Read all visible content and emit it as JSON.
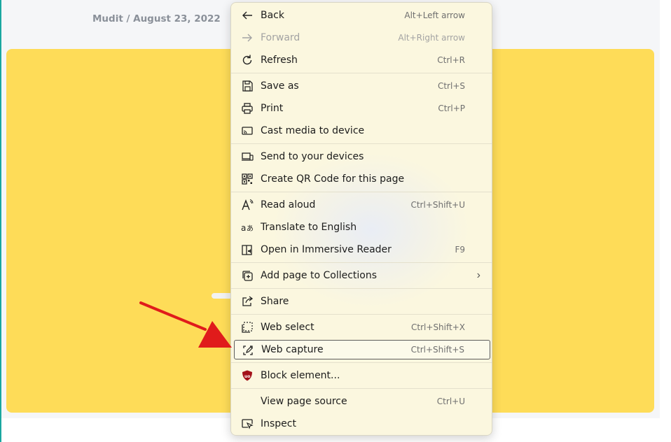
{
  "article": {
    "byline": "Mudit / August 23, 2022"
  },
  "menu": {
    "items": [
      {
        "label": "Back",
        "shortcut": "Alt+Left arrow",
        "icon": "back-arrow-icon"
      },
      {
        "label": "Forward",
        "shortcut": "Alt+Right arrow",
        "icon": "forward-arrow-icon"
      },
      {
        "label": "Refresh",
        "shortcut": "Ctrl+R",
        "icon": "refresh-icon"
      },
      {
        "label": "Save as",
        "shortcut": "Ctrl+S",
        "icon": "save-icon"
      },
      {
        "label": "Print",
        "shortcut": "Ctrl+P",
        "icon": "printer-icon"
      },
      {
        "label": "Cast media to device",
        "shortcut": "",
        "icon": "cast-icon"
      },
      {
        "label": "Send to your devices",
        "shortcut": "",
        "icon": "devices-icon"
      },
      {
        "label": "Create QR Code for this page",
        "shortcut": "",
        "icon": "qr-code-icon"
      },
      {
        "label": "Read aloud",
        "shortcut": "Ctrl+Shift+U",
        "icon": "read-aloud-icon"
      },
      {
        "label": "Translate to English",
        "shortcut": "",
        "icon": "translate-icon"
      },
      {
        "label": "Open in Immersive Reader",
        "shortcut": "F9",
        "icon": "immersive-reader-icon"
      },
      {
        "label": "Add page to Collections",
        "shortcut": "",
        "icon": "collections-icon"
      },
      {
        "label": "Share",
        "shortcut": "",
        "icon": "share-icon"
      },
      {
        "label": "Web select",
        "shortcut": "Ctrl+Shift+X",
        "icon": "web-select-icon"
      },
      {
        "label": "Web capture",
        "shortcut": "Ctrl+Shift+S",
        "icon": "web-capture-icon"
      },
      {
        "label": "Block element...",
        "shortcut": "",
        "icon": "ublock-shield-icon"
      },
      {
        "label": "View page source",
        "shortcut": "Ctrl+U",
        "icon": ""
      },
      {
        "label": "Inspect",
        "shortcut": "",
        "icon": "inspect-icon"
      }
    ]
  },
  "colors": {
    "banner": "#fedc58",
    "arrow": "#e01b1b",
    "ublock": "#a3111a"
  }
}
